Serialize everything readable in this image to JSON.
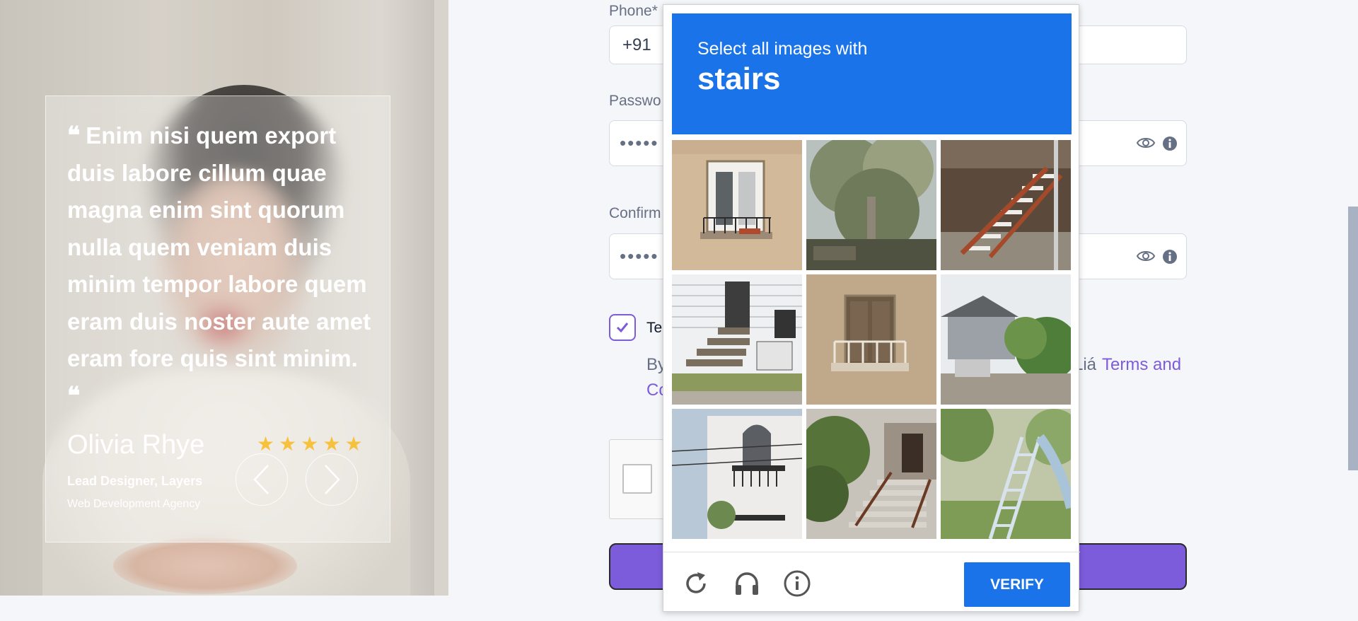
{
  "testimonial": {
    "quote": "Enim nisi quem export duis labore cillum quae magna enim sint quorum nulla quem veniam duis minim tempor labore quem eram duis noster aute amet eram fore quis sint minim.",
    "open_mark": "❝",
    "close_mark": "❝",
    "name": "Olivia Rhye",
    "role": "Lead Designer, Layers",
    "company": "Web Development Agency",
    "rating": 5
  },
  "form": {
    "phone_label": "Phone*",
    "phone_code": "+91",
    "password_label": "Passwo",
    "password_mask": "•••••",
    "confirm_label": "Confirm",
    "confirm_mask": "•••••",
    "terms_label": "Te",
    "by_text": "By",
    "terms_link_prefix": "Liá",
    "terms_link": "Terms and",
    "terms_link_wrap": "Co"
  },
  "captcha": {
    "instruction": "Select all images with",
    "target": "stairs",
    "tiles": [
      "balcony-building",
      "tree",
      "wooden-stairs",
      "porch-steps",
      "balcony-facade",
      "house-garden",
      "white-building",
      "entrance-steps",
      "playground-slide"
    ],
    "verify_label": "VERIFY",
    "footer_icons": [
      "reload-icon",
      "audio-icon",
      "info-icon"
    ],
    "accent_color": "#1a73e8"
  },
  "colors": {
    "primary": "#7c5cdb",
    "star": "#f6c23e"
  }
}
